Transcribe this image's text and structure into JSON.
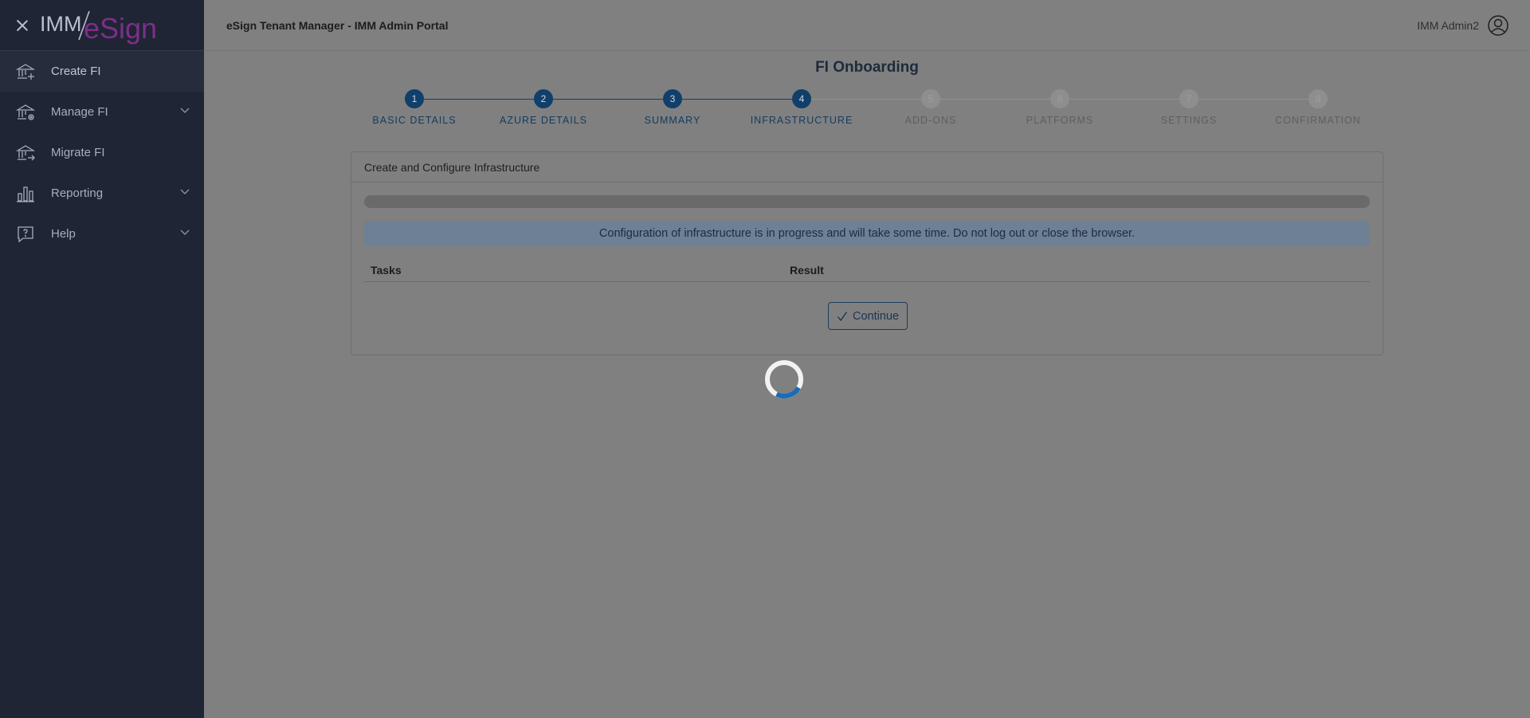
{
  "sidebar": {
    "logo": {
      "part1": "IMM",
      "part2": "eSign"
    },
    "items": [
      {
        "label": "Create FI",
        "icon": "bank-plus-icon",
        "active": true,
        "expandable": false
      },
      {
        "label": "Manage FI",
        "icon": "bank-gear-icon",
        "active": false,
        "expandable": true
      },
      {
        "label": "Migrate FI",
        "icon": "bank-arrow-icon",
        "active": false,
        "expandable": false
      },
      {
        "label": "Reporting",
        "icon": "bar-chart-icon",
        "active": false,
        "expandable": true
      },
      {
        "label": "Help",
        "icon": "help-bubble-icon",
        "active": false,
        "expandable": true
      }
    ]
  },
  "header": {
    "title": "eSign Tenant Manager - IMM Admin Portal",
    "user_name": "IMM Admin2"
  },
  "main": {
    "page_title": "FI Onboarding",
    "current_step": 4,
    "steps": [
      {
        "number": "1",
        "label": "BASIC DETAILS"
      },
      {
        "number": "2",
        "label": "AZURE DETAILS"
      },
      {
        "number": "3",
        "label": "SUMMARY"
      },
      {
        "number": "4",
        "label": "INFRASTRUCTURE"
      },
      {
        "number": "5",
        "label": "ADD-ONS"
      },
      {
        "number": "6",
        "label": "PLATFORMS"
      },
      {
        "number": "7",
        "label": "SETTINGS"
      },
      {
        "number": "8",
        "label": "CONFIRMATION"
      }
    ],
    "card": {
      "title": "Create and Configure Infrastructure",
      "progress_fraction": 0.0,
      "alert": "Configuration of infrastructure is in progress and will take some time. Do not log out or close the browser.",
      "table_headers": {
        "tasks": "Tasks",
        "result": "Result"
      },
      "continue_label": "Continue"
    }
  },
  "colors": {
    "sidebar_bg": "#1f2535",
    "step_done": "#0f3f6a",
    "step_todo": "#8e8e8e",
    "spinner_accent": "#1a6bb8"
  }
}
